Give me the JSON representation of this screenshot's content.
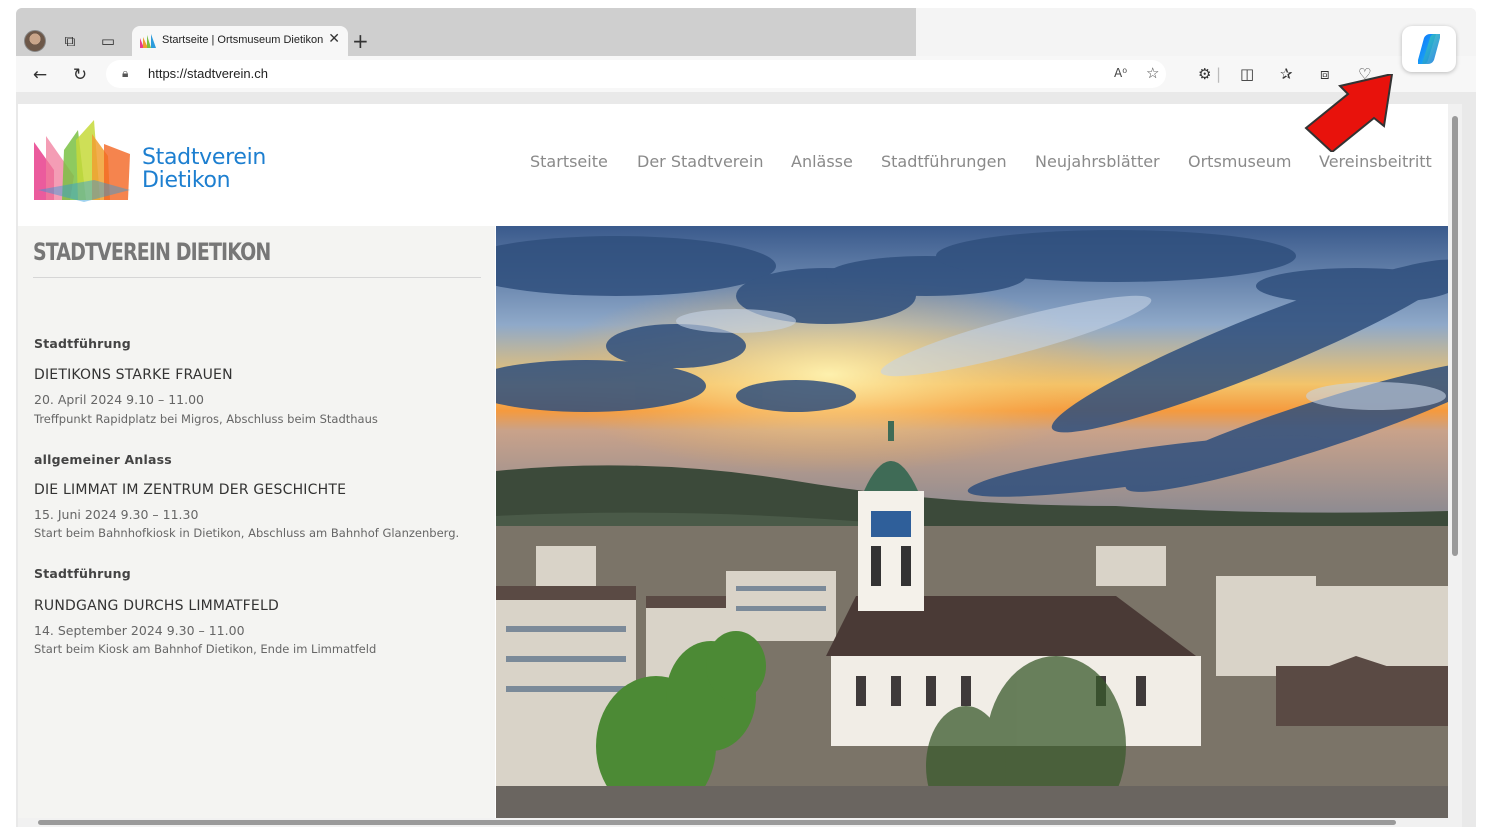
{
  "browser": {
    "tab_title": "Startseite | Ortsmuseum Dietikon",
    "tab_close": "✕",
    "new_tab": "+",
    "url": "https://stadtverein.ch",
    "read_aloud": "A⁰",
    "back": "←",
    "reload": "↻"
  },
  "site": {
    "logo_line1": "Stadtverein",
    "logo_line2": "Dietikon",
    "nav": [
      "Startseite",
      "Der Stadtverein",
      "Anlässe",
      "Stadtführungen",
      "Neujahrsblätter",
      "Ortsmuseum",
      "Vereinsbeitritt"
    ]
  },
  "sidebar": {
    "title": "STADTVEREIN DIETIKON",
    "events": [
      {
        "category": "Stadtführung",
        "title": "DIETIKONS STARKE FRAUEN",
        "date": "20. April 2024 9.10 – 11.00",
        "location": "Treffpunkt Rapidplatz bei Migros, Abschluss beim Stadthaus"
      },
      {
        "category": "allgemeiner Anlass",
        "title": "DIE LIMMAT IM ZENTRUM DER GESCHICHTE",
        "date": "15. Juni 2024 9.30 – 11.30",
        "location": "Start beim Bahnhofkiosk in Dietikon, Abschluss am Bahnhof Glanzenberg."
      },
      {
        "category": "Stadtführung",
        "title": "RUNDGANG DURCHS LIMMATFELD",
        "date": "14. September 2024 9.30 – 11.00",
        "location": "Start beim Kiosk am Bahnhof Dietikon, Ende im Limmatfeld"
      }
    ]
  },
  "colors": {
    "brand_blue": "#1d7fd0",
    "nav_gray": "#8a8a8a",
    "annotation_red": "#e8120c"
  },
  "icons": [
    "profile-avatar",
    "workspaces-icon",
    "vertical-tabs-icon",
    "back-icon",
    "reload-icon",
    "lock-icon",
    "read-aloud-icon",
    "favorite-star-icon",
    "extensions-icon",
    "split-screen-icon",
    "favorites-icon",
    "collections-icon",
    "copilot-icon"
  ]
}
